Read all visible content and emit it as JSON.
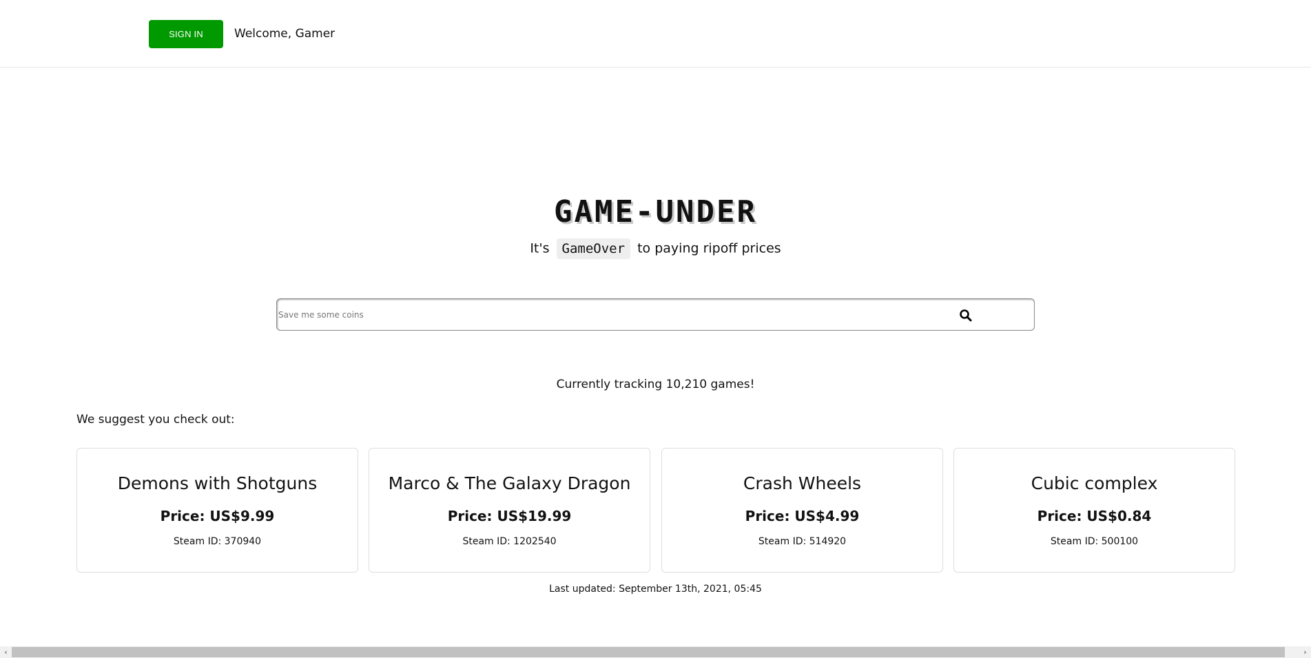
{
  "header": {
    "signin_label": "SIGN IN",
    "welcome": "Welcome, Gamer"
  },
  "hero": {
    "brand": "GAME-UNDER",
    "tagline_before": "It's",
    "tagline_code": "GameOver",
    "tagline_after": "to paying ripoff prices"
  },
  "search": {
    "placeholder": "Save me some coins",
    "value": "",
    "icon": "search-icon"
  },
  "tracking": "Currently tracking 10,210 games!",
  "suggest_heading": "We suggest you check out:",
  "suggestions": [
    {
      "title": "Demons with Shotguns",
      "price": "Price: US$9.99",
      "steam": "Steam ID: 370940"
    },
    {
      "title": "Marco & The Galaxy Dragon",
      "price": "Price: US$19.99",
      "steam": "Steam ID: 1202540"
    },
    {
      "title": "Crash Wheels",
      "price": "Price: US$4.99",
      "steam": "Steam ID: 514920"
    },
    {
      "title": "Cubic complex",
      "price": "Price: US$0.84",
      "steam": "Steam ID: 500100"
    }
  ],
  "last_updated": "Last updated: September 13th, 2021, 05:45",
  "scrollbar": {
    "left_arrow": "‹",
    "right_arrow": "›"
  },
  "colors": {
    "signin_bg": "#009900",
    "text": "#111111",
    "card_border": "#dedede"
  }
}
